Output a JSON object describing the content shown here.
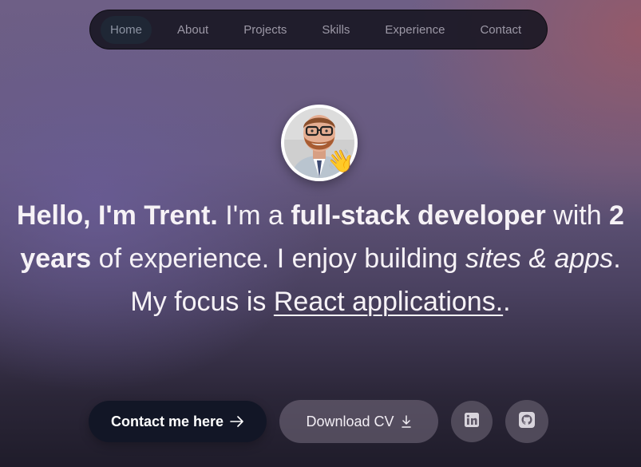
{
  "nav": {
    "items": [
      {
        "label": "Home",
        "active": true
      },
      {
        "label": "About",
        "active": false
      },
      {
        "label": "Projects",
        "active": false
      },
      {
        "label": "Skills",
        "active": false
      },
      {
        "label": "Experience",
        "active": false
      },
      {
        "label": "Contact",
        "active": false
      }
    ]
  },
  "avatar": {
    "icon": "profile-photo",
    "badge_emoji": "👋"
  },
  "intro": {
    "greeting_bold": "Hello, I'm Trent.",
    "text_1": " I'm a ",
    "role_bold": "full-stack developer",
    "text_2": " with ",
    "years_bold": "2 years",
    "text_3": " of experience. I enjoy building ",
    "sites_italic": "sites & apps",
    "text_4": ". My focus is ",
    "focus_underlined": "React applications.",
    "text_5": "."
  },
  "buttons": {
    "contact_label": "Contact me here",
    "contact_icon": "arrow-right-icon",
    "cv_label": "Download CV",
    "cv_icon": "download-icon"
  },
  "social": {
    "linkedin_icon": "linkedin-icon",
    "github_icon": "github-icon"
  },
  "colors": {
    "nav_bg": "#16141f",
    "nav_active_bg": "#1f2735",
    "primary_button": "#121626",
    "text": "#f6f2f6"
  }
}
